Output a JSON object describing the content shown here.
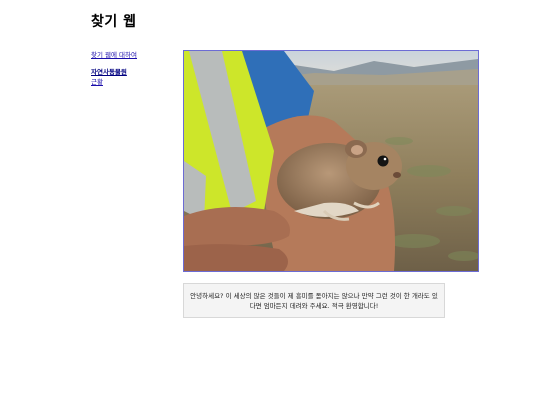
{
  "site": {
    "title": "찾기 웹"
  },
  "sidebar": {
    "about_link": "찾기 웹에 대하여",
    "items": [
      {
        "label": "자연사동물원",
        "active": true
      },
      {
        "label": "근황",
        "active": false
      }
    ]
  },
  "main": {
    "caption": "안녕하세요? 이 세상의 많은 것들이 제 흥미를 돋아지는 않으나 만약 그런 것이 한 개라도 있다면 엄마든지 데려와 주세요. 적극 환영합니다!"
  }
}
